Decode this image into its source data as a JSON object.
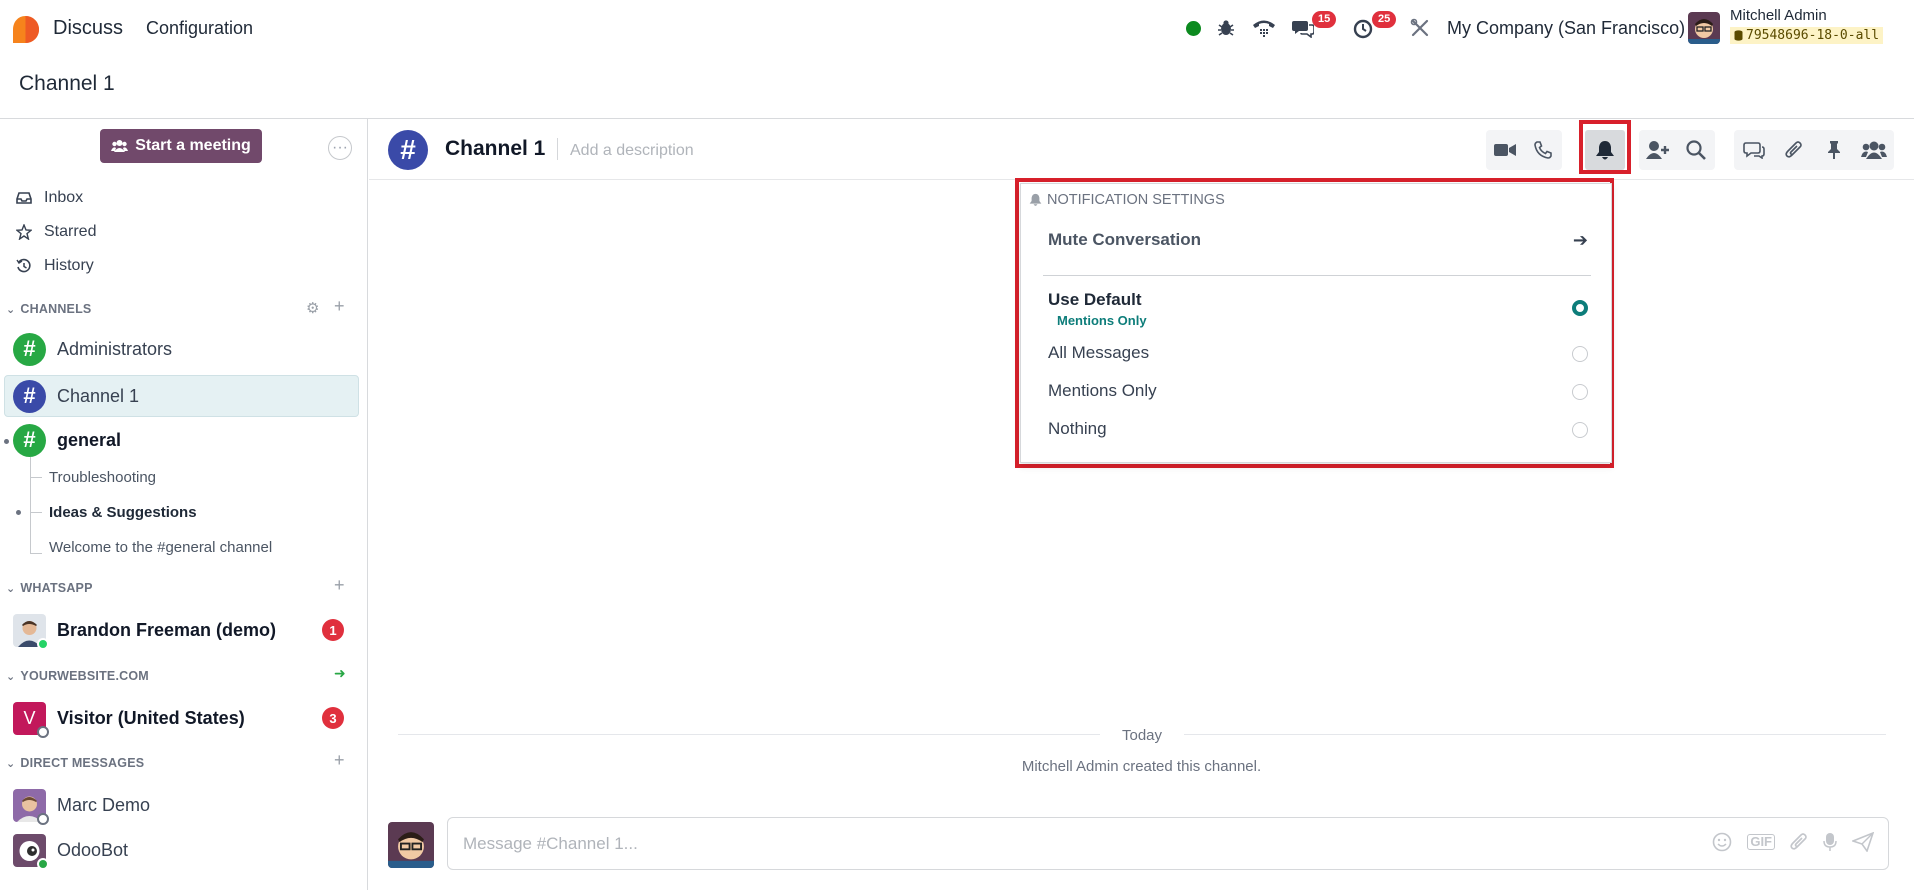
{
  "navbar": {
    "app_name": "Discuss",
    "menu_configuration": "Configuration",
    "messages_badge": "15",
    "activities_badge": "25",
    "company": "My Company (San Francisco)",
    "user_name": "Mitchell Admin",
    "database": "79548696-18-0-all"
  },
  "breadcrumb": "Channel 1",
  "sidebar": {
    "start_meeting": "Start a meeting",
    "nav": [
      {
        "label": "Inbox",
        "icon": "inbox-icon"
      },
      {
        "label": "Starred",
        "icon": "star-icon"
      },
      {
        "label": "History",
        "icon": "history-icon"
      }
    ],
    "channels_header": "CHANNELS",
    "channels": [
      {
        "label": "Administrators",
        "color": "#27a844"
      },
      {
        "label": "Channel 1",
        "color": "#3a4aa8"
      },
      {
        "label": "general",
        "color": "#27a844"
      }
    ],
    "subchannels": [
      "Troubleshooting",
      "Ideas & Suggestions",
      "Welcome to the #general channel"
    ],
    "whatsapp_header": "WHATSAPP",
    "whatsapp_contact": "Brandon Freeman (demo)",
    "whatsapp_count": "1",
    "website_header": "YOURWEBSITE.COM",
    "visitor": "Visitor (United States)",
    "visitor_initial": "V",
    "visitor_count": "3",
    "dm_header": "DIRECT MESSAGES",
    "dms": [
      "Marc Demo",
      "OdooBot"
    ]
  },
  "thread": {
    "name": "Channel 1",
    "description_placeholder": "Add a description",
    "today": "Today",
    "created_msg": "Mitchell Admin created this channel."
  },
  "notifications": {
    "title": "NOTIFICATION SETTINGS",
    "mute": "Mute Conversation",
    "use_default": "Use Default",
    "use_default_sub": "Mentions Only",
    "all_messages": "All Messages",
    "mentions_only": "Mentions Only",
    "nothing": "Nothing",
    "selected": "Use Default"
  },
  "composer": {
    "placeholder": "Message #Channel 1..."
  },
  "colors": {
    "brand": "#71496b",
    "accent": "#0d7d7a",
    "highlight": "#d8202b"
  }
}
